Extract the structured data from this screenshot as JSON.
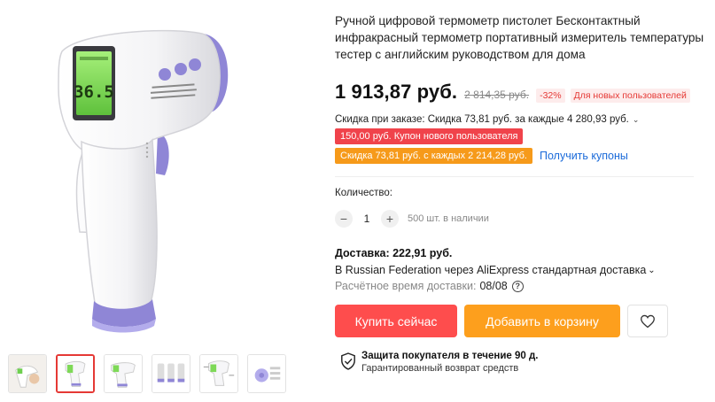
{
  "product": {
    "title": "Ручной цифровой термометр пистолет Бесконтактный инфракрасный термометр портативный измеритель температуры тестер с английским руководством для дома",
    "image_display_reading": "36.5",
    "thumbnail_count": 6,
    "active_thumbnail": 2
  },
  "pricing": {
    "price": "1 913,87 руб.",
    "old_price": "2 814,35 руб.",
    "discount_percent": "-32%",
    "new_users_badge": "Для новых пользователей",
    "order_discount": "Скидка при заказе: Скидка 73,81 руб. за каждые 4 280,93 руб.",
    "coupon_new_user": "150,00 руб. Купон нового пользователя",
    "coupon_discount": "Скидка 73,81 руб. с каждых 2 214,28 руб.",
    "get_coupons_link": "Получить купоны"
  },
  "quantity": {
    "label": "Количество:",
    "minus": "−",
    "value": "1",
    "plus": "+",
    "stock": "500 шт. в наличии"
  },
  "delivery": {
    "title": "Доставка: 222,91 руб.",
    "route": "В Russian Federation через AliExpress стандартная доставка",
    "estimate_label": "Расчётное время доставки:",
    "estimate_date": "08/08",
    "help_glyph": "?"
  },
  "actions": {
    "buy_now": "Купить сейчас",
    "add_to_cart": "Добавить в корзину",
    "wishlist_icon": "heart-icon"
  },
  "protection": {
    "title": "Защита покупателя в течение 90 д.",
    "subtitle": "Гарантированный возврат средств",
    "icon": "shield-check-icon"
  },
  "colors": {
    "accent_red": "#fe4d4d",
    "accent_orange": "#fd9f1d",
    "link_blue": "#1a6ad9",
    "display_green": "#7ed957",
    "device_purple": "#8f86d6"
  }
}
